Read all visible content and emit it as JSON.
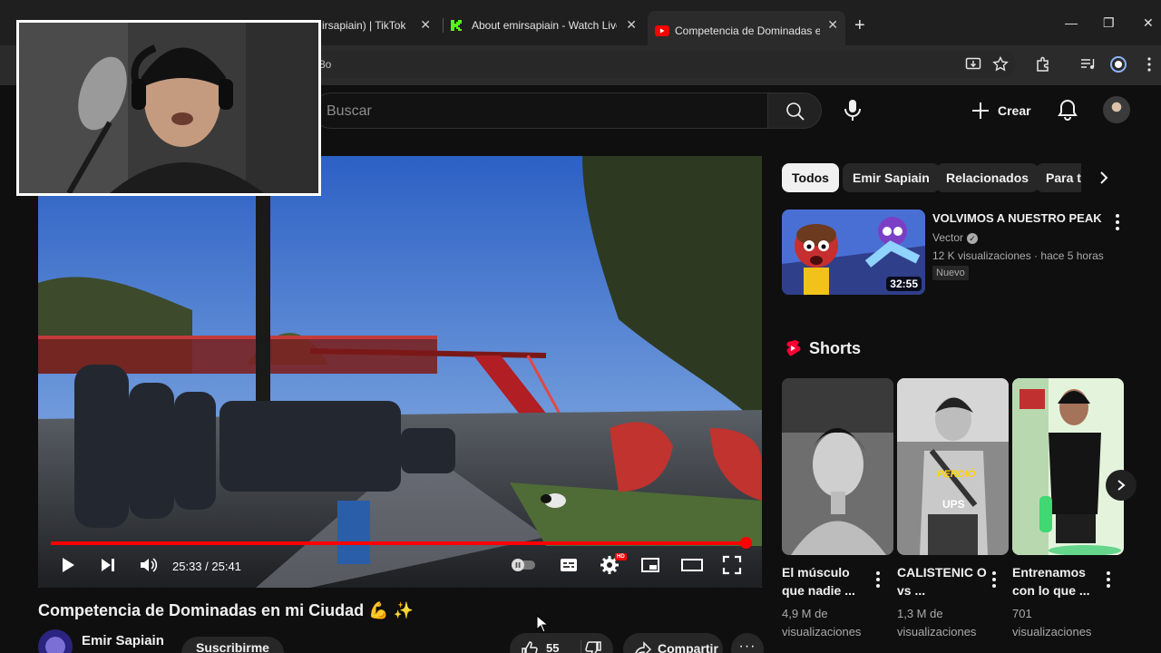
{
  "browser": {
    "tabs": [
      {
        "title": "...irsapiain) | TikTok",
        "close": "✕",
        "icon": "tiktok-icon"
      },
      {
        "title": "About emirsapiain - Watch Live",
        "close": "✕",
        "icon": "kick-icon"
      },
      {
        "title": "Competencia de Dominadas en",
        "close": "✕",
        "icon": "youtube-icon"
      }
    ],
    "new_tab": "+",
    "window_controls": {
      "minimize": "—",
      "restore": "❐",
      "close": "✕"
    },
    "url_fragment": "8o"
  },
  "header": {
    "search_placeholder": "Buscar",
    "create_label": "Crear"
  },
  "player": {
    "current_time": "25:33",
    "total_time": "25:41",
    "time_text": "25:33 / 25:41",
    "progress_fraction": 0.9948,
    "hd_label": "HD"
  },
  "video": {
    "title": "Competencia de Dominadas en mi Ciudad 💪 ✨",
    "channel": "Emir Sapiain",
    "subscribe_label": "Suscribirme",
    "likes": "55",
    "share_label": "Compartir",
    "more_label": "···"
  },
  "sidebar": {
    "chips": [
      {
        "label": "Todos",
        "active": true
      },
      {
        "label": "Emir Sapiain",
        "active": false
      },
      {
        "label": "Relacionados",
        "active": false
      },
      {
        "label": "Para t",
        "active": false
      }
    ],
    "recommended": {
      "title": "VOLVIMOS A NUESTRO PEAK",
      "channel": "Vector",
      "meta": "12 K visualizaciones · hace 5 horas",
      "badge": "Nuevo",
      "duration": "32:55"
    },
    "shorts_label": "Shorts",
    "shorts": [
      {
        "title": "El músculo que nadie ...",
        "views": "4,9 M de visualizaciones"
      },
      {
        "title": "CALISTENIC O vs ...",
        "views": "1,3 M de visualizaciones",
        "overlay_top": "PERDIÓ",
        "overlay_bottom": "UPS"
      },
      {
        "title": "Entrenamos con lo que ...",
        "views": "701 visualizaciones"
      }
    ]
  },
  "colors": {
    "background": "#0f0f0f",
    "accent_red": "#ff0000",
    "chip_active": "#f1f1f1",
    "chip": "#272727"
  }
}
